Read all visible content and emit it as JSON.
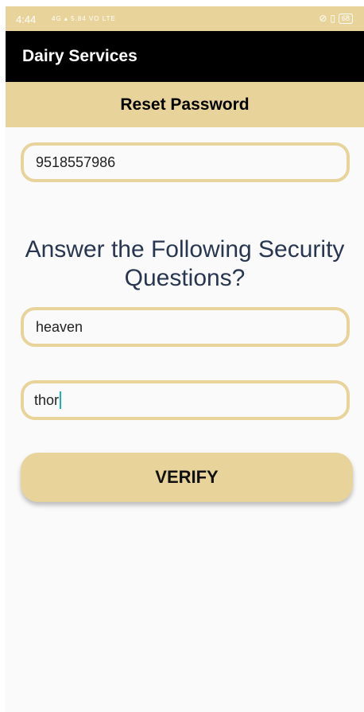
{
  "status_bar": {
    "time": "4:44",
    "network": "4G ▴ 5.84 VO LTE",
    "battery": "68"
  },
  "app_bar": {
    "title": "Dairy Services"
  },
  "subheader": {
    "title": "Reset Password"
  },
  "phone_field": {
    "value": "9518557986"
  },
  "security": {
    "heading": "Answer the Following Security Questions?",
    "answer1": "heaven",
    "answer2": "thor"
  },
  "verify_button": {
    "label": "VERIFY"
  },
  "colors": {
    "accent": "#e8d49b",
    "app_bar": "#000000",
    "heading_text": "#283650",
    "caret": "#14b8b0"
  }
}
